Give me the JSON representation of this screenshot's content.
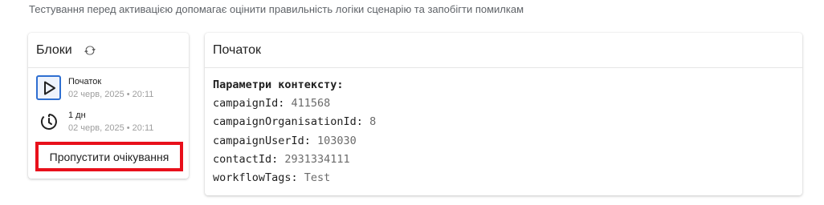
{
  "page": {
    "subtitle": "Тестування перед активацією допомагає оцінити правильність логіки сценарію та запобігти помилкам"
  },
  "blocks_panel": {
    "title": "Блоки",
    "refresh_icon": "refresh-icon",
    "items": [
      {
        "name": "Початок",
        "time": "02 черв, 2025 • 20:11",
        "icon": "play-icon",
        "active": true
      },
      {
        "name": "1 дн",
        "time": "02 черв, 2025 • 20:11",
        "icon": "timer-icon",
        "active": false
      }
    ],
    "skip_button_label": "Пропустити очікування"
  },
  "start_panel": {
    "title": "Початок",
    "context_title": "Параметри контексту:",
    "params": [
      {
        "key": "campaignId:",
        "value": "411568"
      },
      {
        "key": "campaignOrganisationId:",
        "value": "8"
      },
      {
        "key": "campaignUserId:",
        "value": "103030"
      },
      {
        "key": "contactId:",
        "value": "2931334111"
      },
      {
        "key": "workflowTags:",
        "value": "Test"
      }
    ]
  },
  "colors": {
    "accent_blue": "#2f6fd1",
    "highlight_red": "#e8101b",
    "muted_text": "#9e9e9e"
  }
}
